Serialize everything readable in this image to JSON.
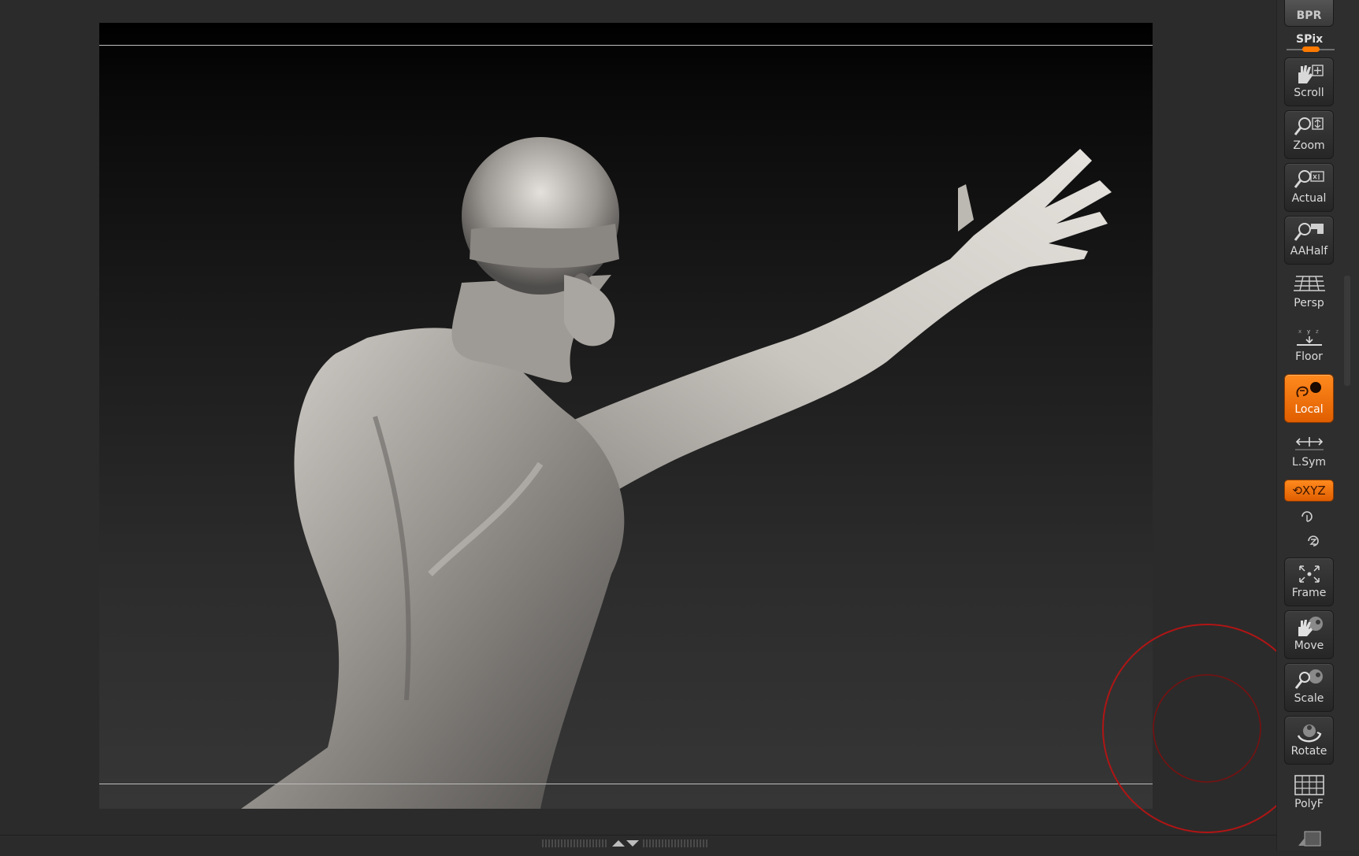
{
  "right_shelf": {
    "bpr_label": "BPR",
    "spix_label": "SPix",
    "buttons": [
      {
        "label": "Scroll",
        "icon": "scroll-hand-icon",
        "active": false
      },
      {
        "label": "Zoom",
        "icon": "zoom-magnifier-icon",
        "active": false
      },
      {
        "label": "Actual",
        "icon": "actual-size-icon",
        "active": false
      },
      {
        "label": "AAHalf",
        "icon": "aahalf-icon",
        "active": false
      },
      {
        "label": "Persp",
        "icon": "perspective-grid-icon",
        "active": false
      },
      {
        "label": "Floor",
        "icon": "floor-icon",
        "active": false
      },
      {
        "label": "Local",
        "icon": "local-transform-icon",
        "active": true
      },
      {
        "label": "L.Sym",
        "icon": "local-symmetry-icon",
        "active": false
      },
      {
        "label": "Frame",
        "icon": "frame-icon",
        "active": false
      },
      {
        "label": "Move",
        "icon": "move-hand-icon",
        "active": false
      },
      {
        "label": "Scale",
        "icon": "scale-icon",
        "active": false
      },
      {
        "label": "Rotate",
        "icon": "rotate-icon",
        "active": false
      },
      {
        "label": "PolyF",
        "icon": "polyframe-grid-icon",
        "active": false
      }
    ],
    "xyz_label": "XYZ",
    "colors": {
      "accent": "#ff7a00",
      "panel": "#2e2e2e",
      "button": "#333333"
    }
  },
  "canvas": {
    "content": "3d-sculpt-model",
    "guide_color": "#bdbdbd"
  },
  "gizmo": {
    "color": "#b01515"
  }
}
